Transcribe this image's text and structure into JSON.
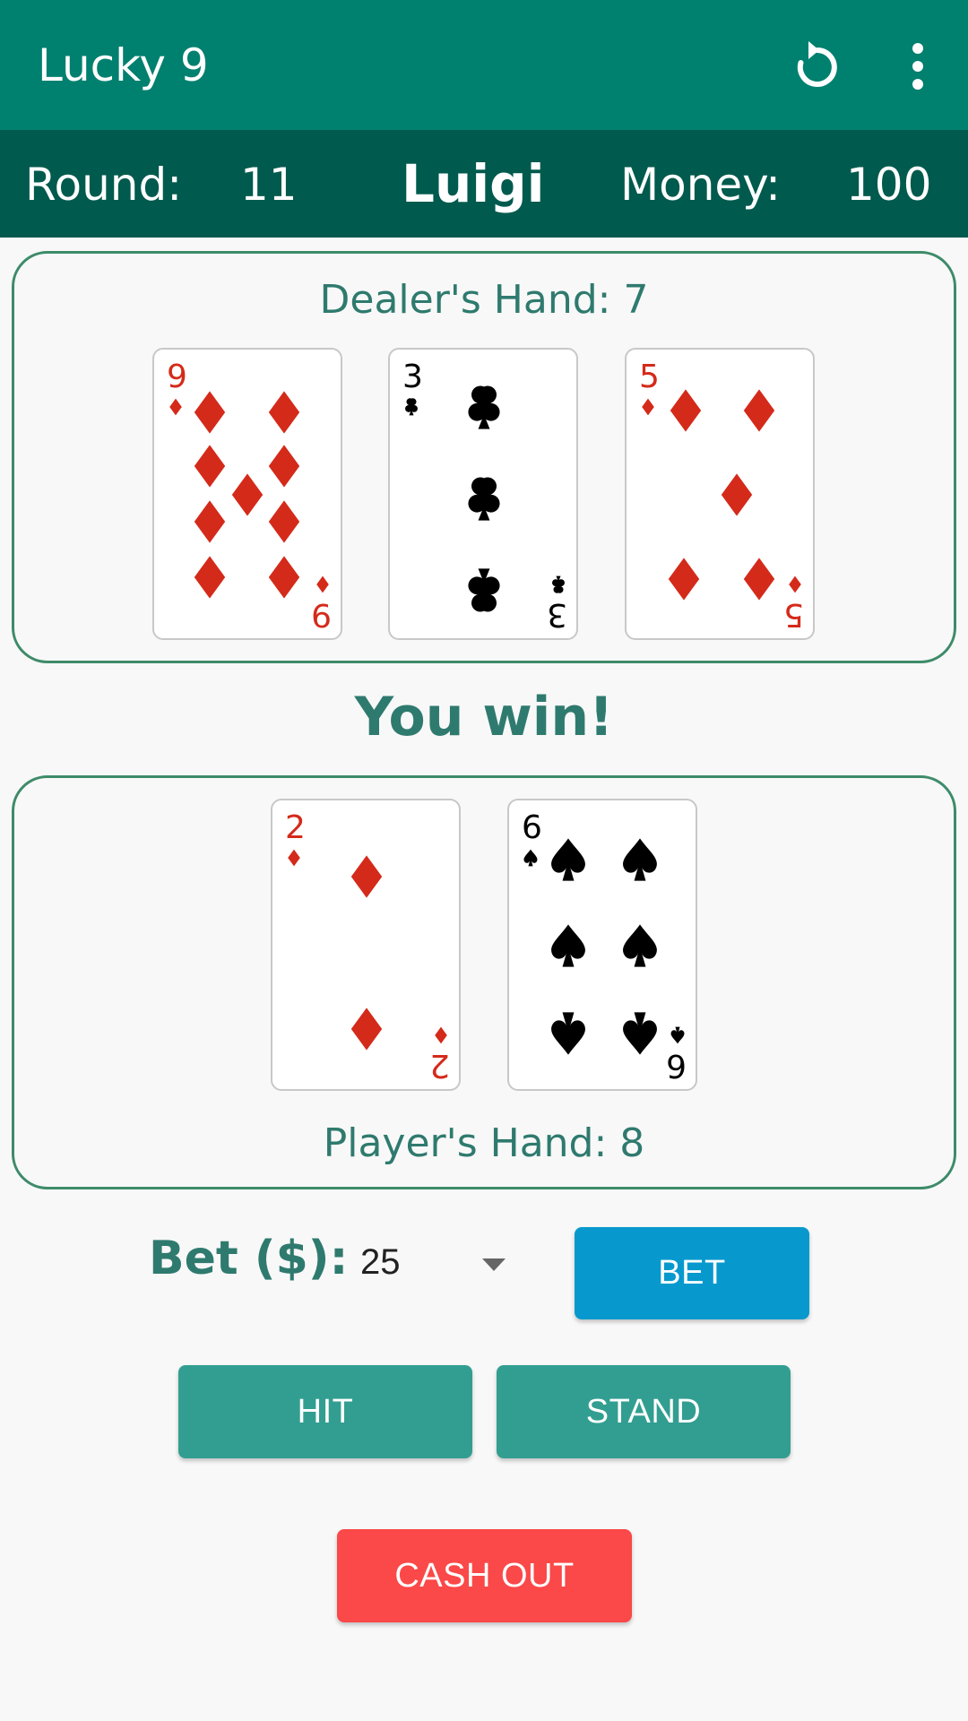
{
  "appbar": {
    "title": "Lucky 9",
    "refresh_icon": "refresh-icon",
    "menu_icon": "more-vert-icon"
  },
  "status": {
    "round_label": "Round:",
    "round_value": "11",
    "player_name": "Luigi",
    "money_label": "Money:",
    "money_value": "100"
  },
  "dealer": {
    "label": "Dealer's Hand: 7",
    "cards": [
      {
        "rank": "9",
        "suit": "diamonds"
      },
      {
        "rank": "3",
        "suit": "clubs"
      },
      {
        "rank": "5",
        "suit": "diamonds"
      }
    ]
  },
  "result": "You win!",
  "player": {
    "label": "Player's Hand: 8",
    "cards": [
      {
        "rank": "2",
        "suit": "diamonds"
      },
      {
        "rank": "6",
        "suit": "spades"
      }
    ]
  },
  "bet": {
    "label": "Bet ($):",
    "selected": "25",
    "button_label": "BET"
  },
  "actions": {
    "hit_label": "HIT",
    "stand_label": "STAND",
    "cashout_label": "CASH OUT"
  },
  "colors": {
    "appbar": "#00806f",
    "statusbar": "#005a4d",
    "accent_text": "#2f7a6e",
    "bet_button": "#0799cd",
    "action_button": "#329e91",
    "cashout_button": "#fb4848",
    "red_suit": "#d42a1a",
    "black_suit": "#000000"
  }
}
